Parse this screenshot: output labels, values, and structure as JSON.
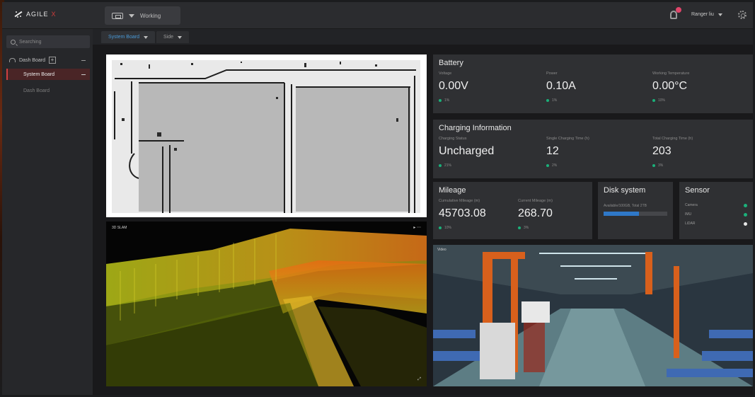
{
  "app": {
    "logo_text": "AGILE",
    "logo_suffix": "X"
  },
  "header": {
    "robot_status": "Working",
    "user_name": "Ranger liu"
  },
  "sidebar": {
    "search_placeholder": "Searching",
    "parent_label": "Dash Board",
    "parent_add": "+",
    "items": [
      {
        "label": "System Board",
        "active": true
      },
      {
        "label": "Dash Board",
        "active": false
      }
    ]
  },
  "tabs": [
    {
      "label": "System Board",
      "active": true
    },
    {
      "label": "Side",
      "active": false
    }
  ],
  "battery": {
    "title": "Battery",
    "metrics": [
      {
        "label": "Voltage",
        "value": "0.00V",
        "delta": "1%"
      },
      {
        "label": "Power",
        "value": "0.10A",
        "delta": "1%"
      },
      {
        "label": "Working Temperature",
        "value": "0.00°C",
        "delta": "10%"
      }
    ]
  },
  "charging": {
    "title": "Charging Information",
    "metrics": [
      {
        "label": "Charging Status",
        "value": "Uncharged",
        "delta": "21%"
      },
      {
        "label": "Single Charging Time (h)",
        "value": "12",
        "delta": "2%"
      },
      {
        "label": "Total Charging Time (h)",
        "value": "203",
        "delta": "3%"
      }
    ]
  },
  "mileage": {
    "title": "Mileage",
    "metrics": [
      {
        "label": "Cumulative Mileage (m)",
        "value": "45703.08",
        "delta": "10%"
      },
      {
        "label": "Current Mileage (m)",
        "value": "268.70",
        "delta": "3%"
      }
    ]
  },
  "disk": {
    "title": "Disk system",
    "label": "Available/100GB, Total 2TB",
    "usage_fraction": 0.55,
    "bar_color": "#2f78c8"
  },
  "sensor": {
    "title": "Sensor",
    "rows": [
      {
        "label": "Camera",
        "color": "#1bb07a"
      },
      {
        "label": "IMU",
        "color": "#1bb07a"
      },
      {
        "label": "LiDAR",
        "color": "#e8e8e8"
      }
    ]
  },
  "lidar": {
    "label": "3D SLAM"
  },
  "video": {
    "label": "Video"
  },
  "colors": {
    "accent": "#4a9ad8",
    "active_bg": "#4a2526",
    "active_border": "#d04040",
    "ok": "#1bb07a"
  }
}
